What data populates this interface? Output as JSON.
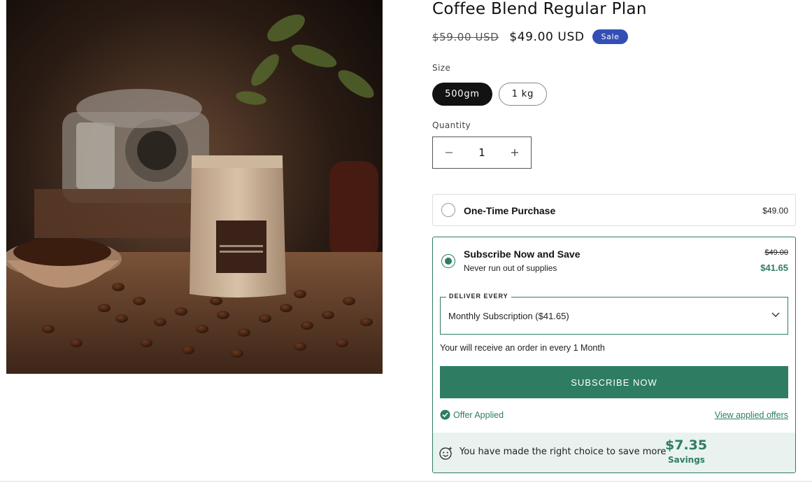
{
  "product": {
    "title": "Coffee Blend Regular Plan",
    "compare_price": "$59.00 USD",
    "price": "$49.00 USD",
    "badge": "Sale"
  },
  "size": {
    "label": "Size",
    "options": [
      "500gm",
      "1 kg"
    ],
    "selected": "500gm"
  },
  "quantity": {
    "label": "Quantity",
    "value": "1",
    "decrease_icon": "minus-icon",
    "increase_icon": "plus-icon"
  },
  "one_time": {
    "title": "One-Time Purchase",
    "price": "$49.00"
  },
  "subscribe": {
    "title": "Subscribe Now and Save",
    "subtitle": "Never run out of supplies",
    "old_price": "$49.00",
    "new_price": "$41.65",
    "deliver_label": "DELIVER EVERY",
    "deliver_value": "Monthly Subscription ($41.65)",
    "receive_note": "Your will receive an order in every 1 Month",
    "button_label": "SUBSCRIBE NOW",
    "offer_applied": "Offer Applied",
    "view_offers": "View applied offers",
    "savings_message": "You have made the right choice to save more",
    "savings_amount": "$7.35",
    "savings_label": "Savings"
  },
  "colors": {
    "accent": "#2e7d62",
    "badge": "#334fb4",
    "selected_pill": "#121212"
  }
}
